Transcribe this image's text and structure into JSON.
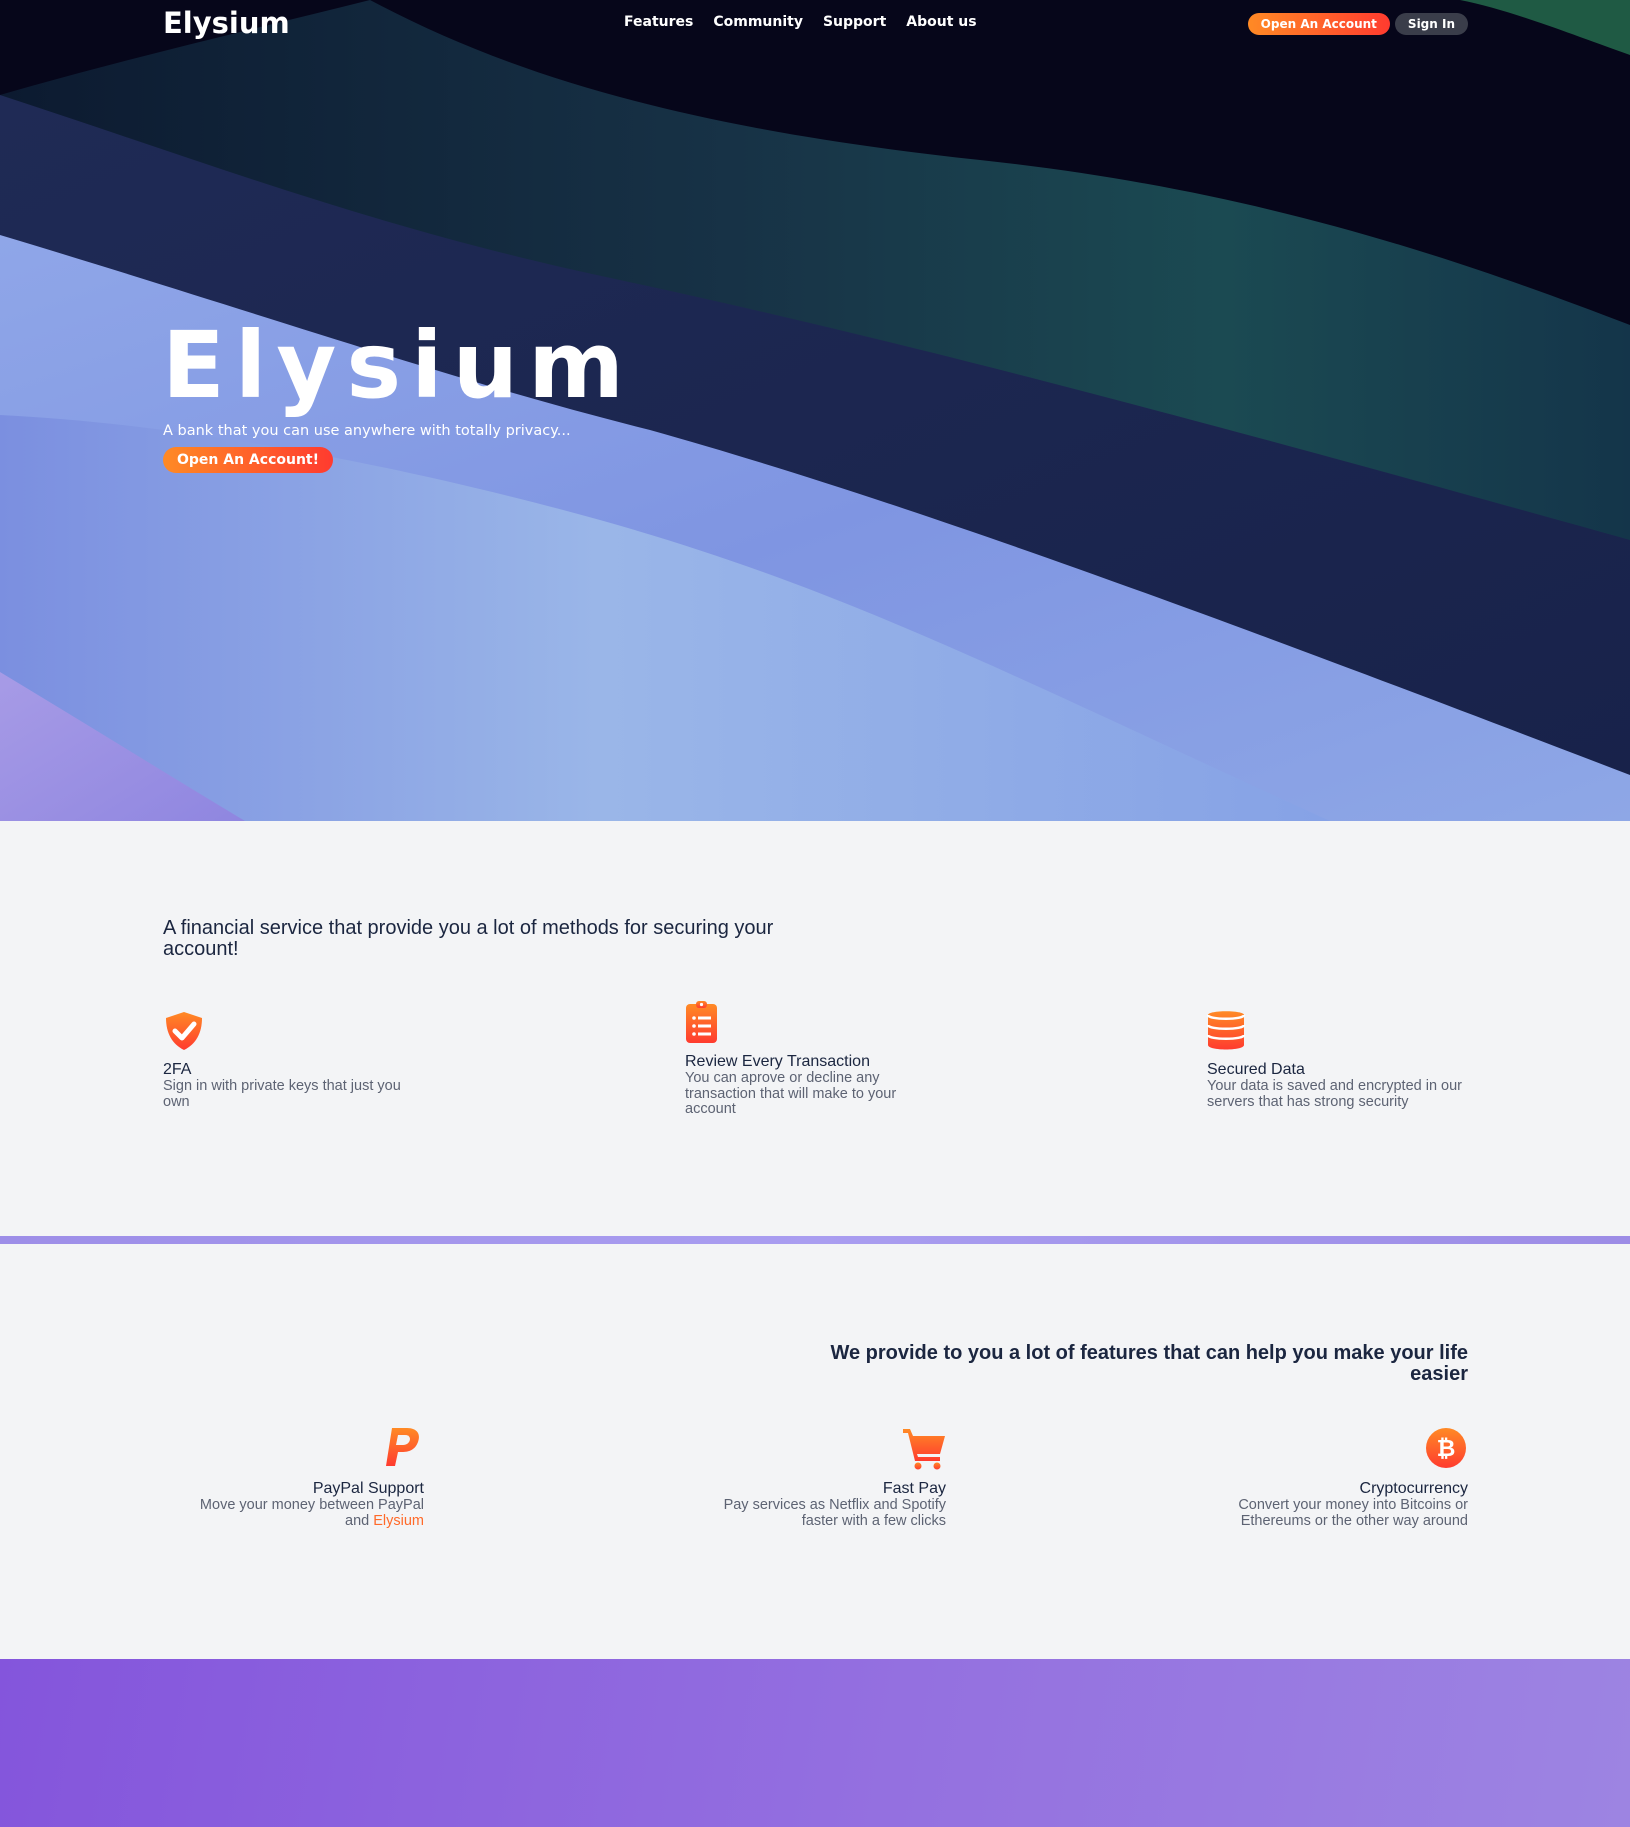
{
  "nav": {
    "brand": "Elysium",
    "links": [
      "Features",
      "Community",
      "Support",
      "About us"
    ],
    "open_account": "Open An Account",
    "sign_in": "Sign In"
  },
  "hero": {
    "title": "Elysium",
    "subtitle": "A bank that you can use anywhere with totally privacy...",
    "cta": "Open An Account!"
  },
  "security": {
    "heading": "A financial service that provide you a lot of methods for securing your account!",
    "features": [
      {
        "icon": "shield-check-icon",
        "title": "2FA",
        "desc": "Sign in with private keys that just you own"
      },
      {
        "icon": "clipboard-list-icon",
        "title": "Review Every Transaction",
        "desc": "You can aprove or decline any transaction that will make to your account"
      },
      {
        "icon": "database-icon",
        "title": "Secured Data",
        "desc": "Your data is saved and encrypted in our servers that has strong security"
      }
    ]
  },
  "features": {
    "heading": "We provide to you a lot of features that can help you make your life easier",
    "items": [
      {
        "icon": "paypal-icon",
        "title": "PayPal Support",
        "desc_prefix": "Move your money between PayPal and ",
        "desc_accent": "Elysium"
      },
      {
        "icon": "shopping-cart-icon",
        "title": "Fast Pay",
        "desc": "Pay services as Netflix and Spotify faster with a few clicks"
      },
      {
        "icon": "bitcoin-icon",
        "title": "Cryptocurrency",
        "desc": "Convert your money into Bitcoins or Ethereums or the other way around"
      }
    ]
  },
  "colors": {
    "accent_orange": "#ff6a2a",
    "hero_dark": "#06061a",
    "footer_purple": "#8a5fdf"
  }
}
